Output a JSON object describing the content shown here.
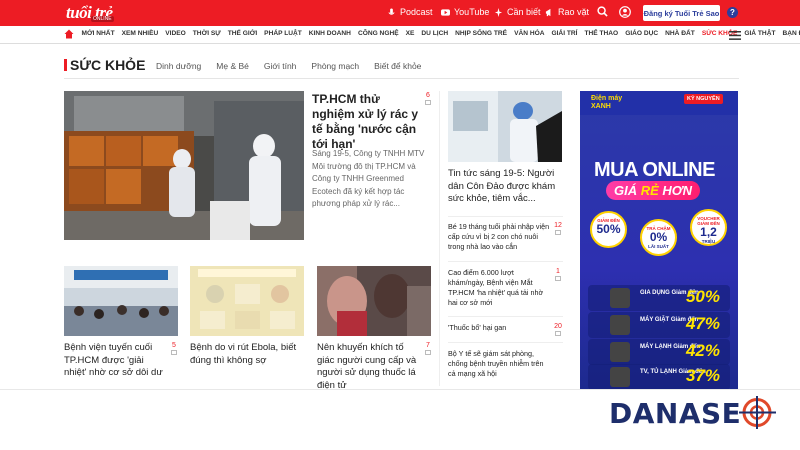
{
  "header": {
    "logo_text": "tuổi trẻ",
    "logo_sub": "ONLINE",
    "links": [
      "Podcast",
      "YouTube",
      "Cần biết",
      "Rao vặt"
    ],
    "register_label": "Đăng ký Tuổi Trẻ Sao",
    "help_label": "?"
  },
  "nav": {
    "items": [
      "MỚI NHẤT",
      "XEM NHIỀU",
      "VIDEO",
      "THỜI SỰ",
      "THẾ GIỚI",
      "PHÁP LUẬT",
      "KINH DOANH",
      "CÔNG NGHỆ",
      "XE",
      "DU LỊCH",
      "NHỊP SỐNG TRẺ",
      "VĂN HÓA",
      "GIẢI TRÍ",
      "THỂ THAO",
      "GIÁO DỤC",
      "NHÀ ĐẤT",
      "SỨC KHỎE",
      "GIẢ THẬT",
      "BẠN ĐỌC"
    ],
    "active": "SỨC KHỎE"
  },
  "section": {
    "title": "SỨC KHỎE",
    "tabs": [
      "Dinh dưỡng",
      "Mẹ & Bé",
      "Giới tính",
      "Phòng mạch",
      "Biết để khỏe"
    ]
  },
  "feature": {
    "title": "TP.HCM thử nghiệm xử lý rác y tế bằng 'nước cận tới hạn'",
    "comments": "6",
    "summary": "Sáng 19-5, Công ty TNHH MTV Môi trường đô thị TP.HCM và Công ty TNHH Greenmed Ecotech đã ký kết hợp tác phương pháp xử lý rác..."
  },
  "right_column": {
    "top_title": "Tin tức sáng 19-5: Người dân Côn Đảo được khám sức khỏe, tiêm vắc...",
    "items": [
      {
        "title": "Bé 19 tháng tuổi phải nhập viện cấp cứu vì bị 2 con chó nuôi trong nhà lao vào cắn",
        "comments": "12"
      },
      {
        "title": "Cao điểm 6.000 lượt khám/ngày, Bệnh viện Mắt TP.HCM 'ha nhiệt' quá tải nhờ hai cơ sở mới",
        "comments": "1"
      },
      {
        "title": "'Thuốc bổ' hại gan",
        "comments": "20"
      },
      {
        "title": "Bộ Y tế sẽ giám sát phòng, chống bệnh truyền nhiễm trên cả mạng xã hội",
        "comments": ""
      }
    ]
  },
  "cards": [
    {
      "title": "Bệnh viện tuyến cuối TP.HCM được 'giải nhiệt' nhờ cơ sở dôi dư",
      "comments": "5"
    },
    {
      "title": "Bệnh do vi rút Ebola, biết đúng thì không sợ",
      "comments": ""
    },
    {
      "title": "Nên khuyến khích tố giác người cung cấp và người sử dụng thuốc lá điện tử",
      "comments": "7"
    }
  ],
  "ad": {
    "brand_line1": "Điện máy",
    "brand_line2": "XANH",
    "badge": "KỶ NGUYÊN",
    "headline": "MUA ONLINE",
    "sub_a": "GIÁ ",
    "sub_b": "RẺ",
    "sub_c": " HƠN",
    "circles": [
      {
        "small": "GIẢM ĐẾN",
        "big": "50%",
        "tail": ""
      },
      {
        "small": "TRẢ CHẬM",
        "big": "0%",
        "tail": "LÃI SUẤT"
      },
      {
        "small": "VOUCHER GIẢM ĐẾN",
        "big": "1,2",
        "tail": "TRIỆU"
      }
    ],
    "rows": [
      {
        "label": "GIA DỤNG Giảm đến",
        "pct": "50%"
      },
      {
        "label": "MÁY GIẶT Giảm đến",
        "pct": "47%"
      },
      {
        "label": "MÁY LẠNH Giảm đến",
        "pct": "42%"
      },
      {
        "label": "TV, TỦ LẠNH Giảm đến",
        "pct": "37%"
      }
    ]
  },
  "watermark": "DANASE"
}
